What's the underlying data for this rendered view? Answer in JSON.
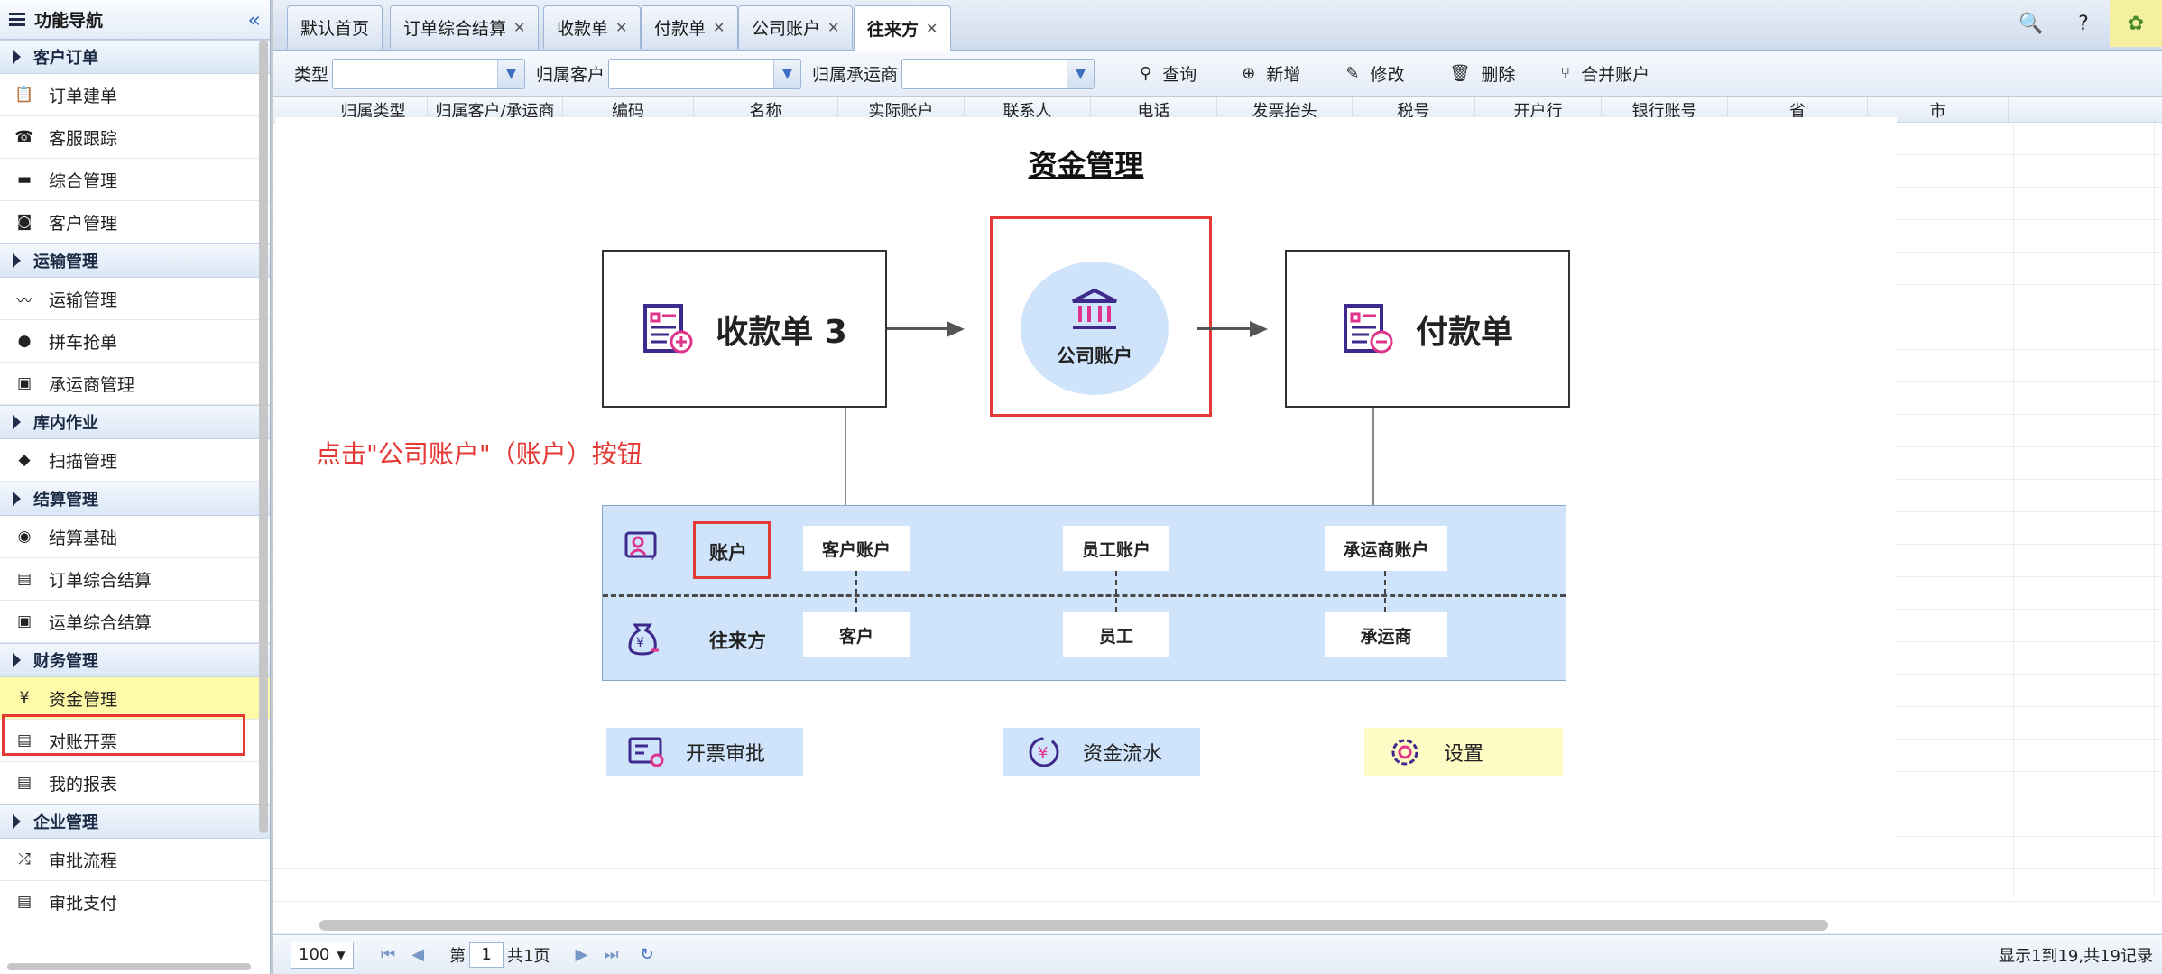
{
  "sidebar": {
    "header": "功能导航",
    "collapse_icon": "«",
    "groups": [
      {
        "title": "客户订单",
        "items": [
          {
            "label": "订单建单",
            "icon": "clipboard-icon"
          },
          {
            "label": "客服跟踪",
            "icon": "phone-icon"
          },
          {
            "label": "综合管理",
            "icon": "monitor-icon"
          },
          {
            "label": "客户管理",
            "icon": "headset-icon"
          }
        ]
      },
      {
        "title": "运输管理",
        "items": [
          {
            "label": "运输管理",
            "icon": "route-icon"
          },
          {
            "label": "拼车抢单",
            "icon": "map-pin-icon"
          },
          {
            "label": "承运商管理",
            "icon": "bus-icon"
          }
        ]
      },
      {
        "title": "库内作业",
        "items": [
          {
            "label": "扫描管理",
            "icon": "cube-icon"
          }
        ]
      },
      {
        "title": "结算管理",
        "items": [
          {
            "label": "结算基础",
            "icon": "eye-icon"
          },
          {
            "label": "订单综合结算",
            "icon": "document-icon"
          },
          {
            "label": "运单综合结算",
            "icon": "bus-icon"
          }
        ]
      },
      {
        "title": "财务管理",
        "items": [
          {
            "label": "资金管理",
            "icon": "yen-icon"
          },
          {
            "label": "对账开票",
            "icon": "document-icon"
          },
          {
            "label": "我的报表",
            "icon": "document-icon"
          }
        ]
      },
      {
        "title": "企业管理",
        "items": [
          {
            "label": "审批流程",
            "icon": "shuffle-icon"
          },
          {
            "label": "审批支付",
            "icon": "document-icon"
          }
        ]
      }
    ]
  },
  "tabs": [
    {
      "label": "默认首页",
      "closable": false
    },
    {
      "label": "订单综合结算",
      "closable": true
    },
    {
      "label": "收款单",
      "closable": true
    },
    {
      "label": "付款单",
      "closable": true
    },
    {
      "label": "公司账户",
      "closable": true
    },
    {
      "label": "往来方",
      "closable": true,
      "active": true
    }
  ],
  "topicons": [
    "search-icon",
    "help-icon",
    "gear-icon"
  ],
  "toolbar": {
    "type_label": "类型",
    "customer_label": "归属客户",
    "carrier_label": "归属承运商",
    "query": "查询",
    "add": "新增",
    "edit": "修改",
    "delete": "删除",
    "merge": "合并账户"
  },
  "grid": {
    "columns": [
      "",
      "归属类型",
      "归属客户/承运商",
      "编码",
      "名称",
      "实际账户",
      "联系人",
      "电话",
      "发票抬头",
      "税号",
      "开户行",
      "银行账号",
      "省",
      "市"
    ]
  },
  "pager": {
    "page_size": "100",
    "page_prefix": "第",
    "page": "1",
    "page_suffix": "共1页",
    "info": "显示1到19,共19记录"
  },
  "overlay": {
    "title": "资金管理",
    "receipt": "收款单 3",
    "company_account": "公司账户",
    "payment": "付款单",
    "instruction": "点击\"公司账户\"（账户）按钮",
    "account_label": "账户",
    "party_label": "往来方",
    "account_chips": [
      "客户账户",
      "员工账户",
      "承运商账户"
    ],
    "party_chips": [
      "客户",
      "员工",
      "承运商"
    ],
    "bottom": {
      "invoice": "开票审批",
      "flow": "资金流水",
      "settings": "设置"
    }
  },
  "colors": {
    "highlight_red": "#e53935",
    "active_nav": "#fffaa8",
    "panel_blue": "#cfe4fb",
    "icon_purple": "#3d2a8c",
    "icon_pink": "#e0338a"
  }
}
